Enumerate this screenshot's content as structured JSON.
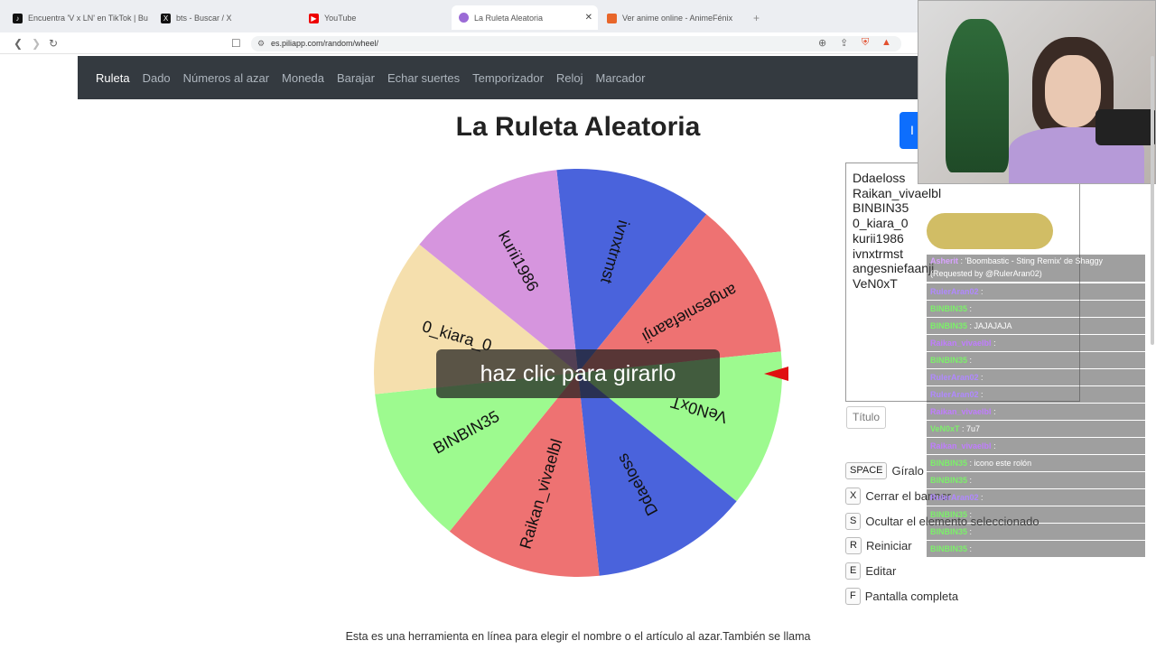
{
  "browser": {
    "tabs": [
      {
        "label": "Encuentra 'V x LN' en TikTok | Busca",
        "icon": "tiktok-icon",
        "active": false
      },
      {
        "label": "bts - Buscar / X",
        "icon": "x-icon",
        "active": false
      },
      {
        "label": "YouTube",
        "icon": "youtube-icon",
        "active": false
      },
      {
        "label": "La Ruleta Aleatoria",
        "icon": "wheel-icon",
        "active": true
      },
      {
        "label": "Ver anime online - AnimeFénix",
        "icon": "anime-icon",
        "active": false
      }
    ],
    "url": "es.piliapp.com/random/wheel/"
  },
  "nav": {
    "items": [
      "Ruleta",
      "Dado",
      "Números al azar",
      "Moneda",
      "Barajar",
      "Echar suertes",
      "Temporizador",
      "Reloj",
      "Marcador"
    ],
    "active": "Ruleta"
  },
  "page": {
    "title": "La Ruleta Aleatoria",
    "blue_button_label": "I",
    "spin_overlay": "haz clic para girarlo",
    "title_placeholder": "Título",
    "description": "Esta es una herramienta en línea para elegir el nombre o el artículo al azar.También se llama"
  },
  "wheel": {
    "segments": [
      {
        "label": "ivnxtrmst",
        "color": "#4a63dc"
      },
      {
        "label": "angesniefaanji",
        "color": "#ee7272"
      },
      {
        "label": "VeN0xT",
        "color": "#9dfa8f"
      },
      {
        "label": "Ddaeloss",
        "color": "#4a63dc"
      },
      {
        "label": "Raikan_vivaelbl",
        "color": "#ee7272"
      },
      {
        "label": "BINBIN35",
        "color": "#9dfa8f"
      },
      {
        "label": "0_kiara_0",
        "color": "#f5dfad"
      },
      {
        "label": "kurii1986",
        "color": "#d695de"
      }
    ],
    "pointer_color": "#e01010"
  },
  "entries": [
    "Ddaeloss",
    "Raikan_vivaelbl",
    "BINBIN35",
    "0_kiara_0",
    "kurii1986",
    "ivnxtrmst",
    "angesniefaanji",
    "VeN0xT"
  ],
  "shortcuts": [
    {
      "key": "SPACE",
      "label": "Gíralo"
    },
    {
      "key": "X",
      "label": "Cerrar el banner"
    },
    {
      "key": "S",
      "label": "Ocultar el elemento seleccionado"
    },
    {
      "key": "R",
      "label": "Reiniciar"
    },
    {
      "key": "E",
      "label": "Editar"
    },
    {
      "key": "F",
      "label": "Pantalla completa"
    }
  ],
  "chat": [
    {
      "user": "Asherit",
      "text": ": 'Boombastic - Sting Remix' de Shaggy (Requested by @RulerAran02)"
    },
    {
      "user": "RulerAran02",
      "text": ":"
    },
    {
      "user": "BINBIN35",
      "text": ":"
    },
    {
      "user": "BINBIN35",
      "text": ": JAJAJAJA"
    },
    {
      "user": "Raikan_vivaelbl",
      "text": ":"
    },
    {
      "user": "BINBIN35",
      "text": ":"
    },
    {
      "user": "RulerAran02",
      "text": ":"
    },
    {
      "user": "RulerAran02",
      "text": ":"
    },
    {
      "user": "Raikan_vivaelbl",
      "text": ":"
    },
    {
      "user": "VeN0xT",
      "text": ": 7u7"
    },
    {
      "user": "Raikan_vivaelbl",
      "text": ":"
    },
    {
      "user": "BINBIN35",
      "text": ": icono este rolón"
    },
    {
      "user": "BINBIN35",
      "text": ":"
    },
    {
      "user": "RulerAran02",
      "text": ":"
    },
    {
      "user": "BINBIN35",
      "text": ":"
    },
    {
      "user": "BINBIN35",
      "text": ":"
    },
    {
      "user": "BINBIN35",
      "text": ":"
    }
  ]
}
